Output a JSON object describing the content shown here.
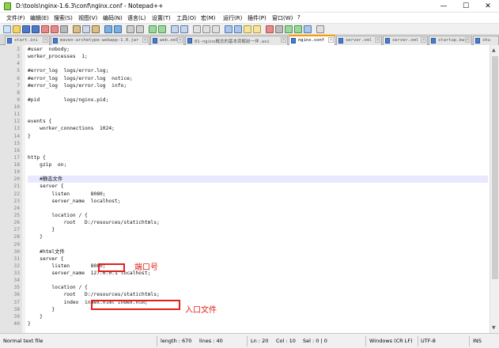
{
  "window": {
    "title": "D:\\tools\\nginx-1.6.3\\conf\\nginx.conf - Notepad++",
    "controls": {
      "minimize": "—",
      "maximize": "☐",
      "close": "✕"
    }
  },
  "menu": [
    "文件(F)",
    "编辑(E)",
    "搜索(S)",
    "视图(V)",
    "编码(N)",
    "语言(L)",
    "设置(T)",
    "工具(O)",
    "宏(M)",
    "运行(R)",
    "插件(P)",
    "窗口(W)",
    "?"
  ],
  "tabs": [
    {
      "label": "start.ini"
    },
    {
      "label": "maven-archetype-webapp-1.0.jar"
    },
    {
      "label": "web.xml"
    },
    {
      "label": "01-nginx概念的基本资解前一伴.avi"
    },
    {
      "label": "nginx.conf",
      "active": true
    },
    {
      "label": "server.xml"
    },
    {
      "label": "server.xml"
    },
    {
      "label": "startup.bat"
    },
    {
      "label": "shu"
    }
  ],
  "editor": {
    "lines": [
      {
        "n": "2",
        "text": "#user  nobody;"
      },
      {
        "n": "3",
        "text": "worker_processes  1;"
      },
      {
        "n": "4",
        "text": ""
      },
      {
        "n": "5",
        "text": "#error_log  logs/error.log;"
      },
      {
        "n": "6",
        "text": "#error_log  logs/error.log  notice;"
      },
      {
        "n": "7",
        "text": "#error_log  logs/error.log  info;"
      },
      {
        "n": "8",
        "text": ""
      },
      {
        "n": "9",
        "text": "#pid        logs/nginx.pid;"
      },
      {
        "n": "10",
        "text": ""
      },
      {
        "n": "11",
        "text": ""
      },
      {
        "n": "12",
        "text": "events {"
      },
      {
        "n": "13",
        "text": "    worker_connections  1024;"
      },
      {
        "n": "14",
        "text": "}"
      },
      {
        "n": "15",
        "text": ""
      },
      {
        "n": "16",
        "text": ""
      },
      {
        "n": "17",
        "text": "http {"
      },
      {
        "n": "18",
        "text": "    gzip  on;"
      },
      {
        "n": "19",
        "text": ""
      },
      {
        "n": "20",
        "text": "    #静态文件"
      },
      {
        "n": "21",
        "text": "    server {"
      },
      {
        "n": "22",
        "text": "        listen       8080;"
      },
      {
        "n": "23",
        "text": "        server_name  localhost;"
      },
      {
        "n": "24",
        "text": ""
      },
      {
        "n": "25",
        "text": "        location / {"
      },
      {
        "n": "26",
        "text": "            root   D:/resources/statichtmls;"
      },
      {
        "n": "27",
        "text": "        }"
      },
      {
        "n": "28",
        "text": "    }"
      },
      {
        "n": "29",
        "text": ""
      },
      {
        "n": "30",
        "text": "    #html文件"
      },
      {
        "n": "31",
        "text": "    server {"
      },
      {
        "n": "32",
        "text": "        listen       8080;"
      },
      {
        "n": "33",
        "text": "        server_name  127.0.0.1 localhost;"
      },
      {
        "n": "34",
        "text": ""
      },
      {
        "n": "35",
        "text": "        location / {"
      },
      {
        "n": "36",
        "text": "            root   D:/resources/statichtmls;"
      },
      {
        "n": "37",
        "text": "            index  index.html index.htm;"
      },
      {
        "n": "38",
        "text": "        }"
      },
      {
        "n": "39",
        "text": "    }"
      },
      {
        "n": "40",
        "text": "}"
      }
    ],
    "current_line": "20"
  },
  "annotations": {
    "port": "端口号",
    "entry": "入口文件"
  },
  "statusbar": {
    "type": "Normal text file",
    "length": "length : 670",
    "lines": "lines : 40",
    "ln": "Ln : 20",
    "col": "Col : 10",
    "sel": "Sel : 0 | 0",
    "eol": "Windows (CR LF)",
    "encoding": "UTF-8",
    "mode": "INS"
  },
  "colors": {
    "annotation": "#e0201b",
    "active_tab_accent": "#ff9900",
    "current_line": "#e8e8ff"
  }
}
